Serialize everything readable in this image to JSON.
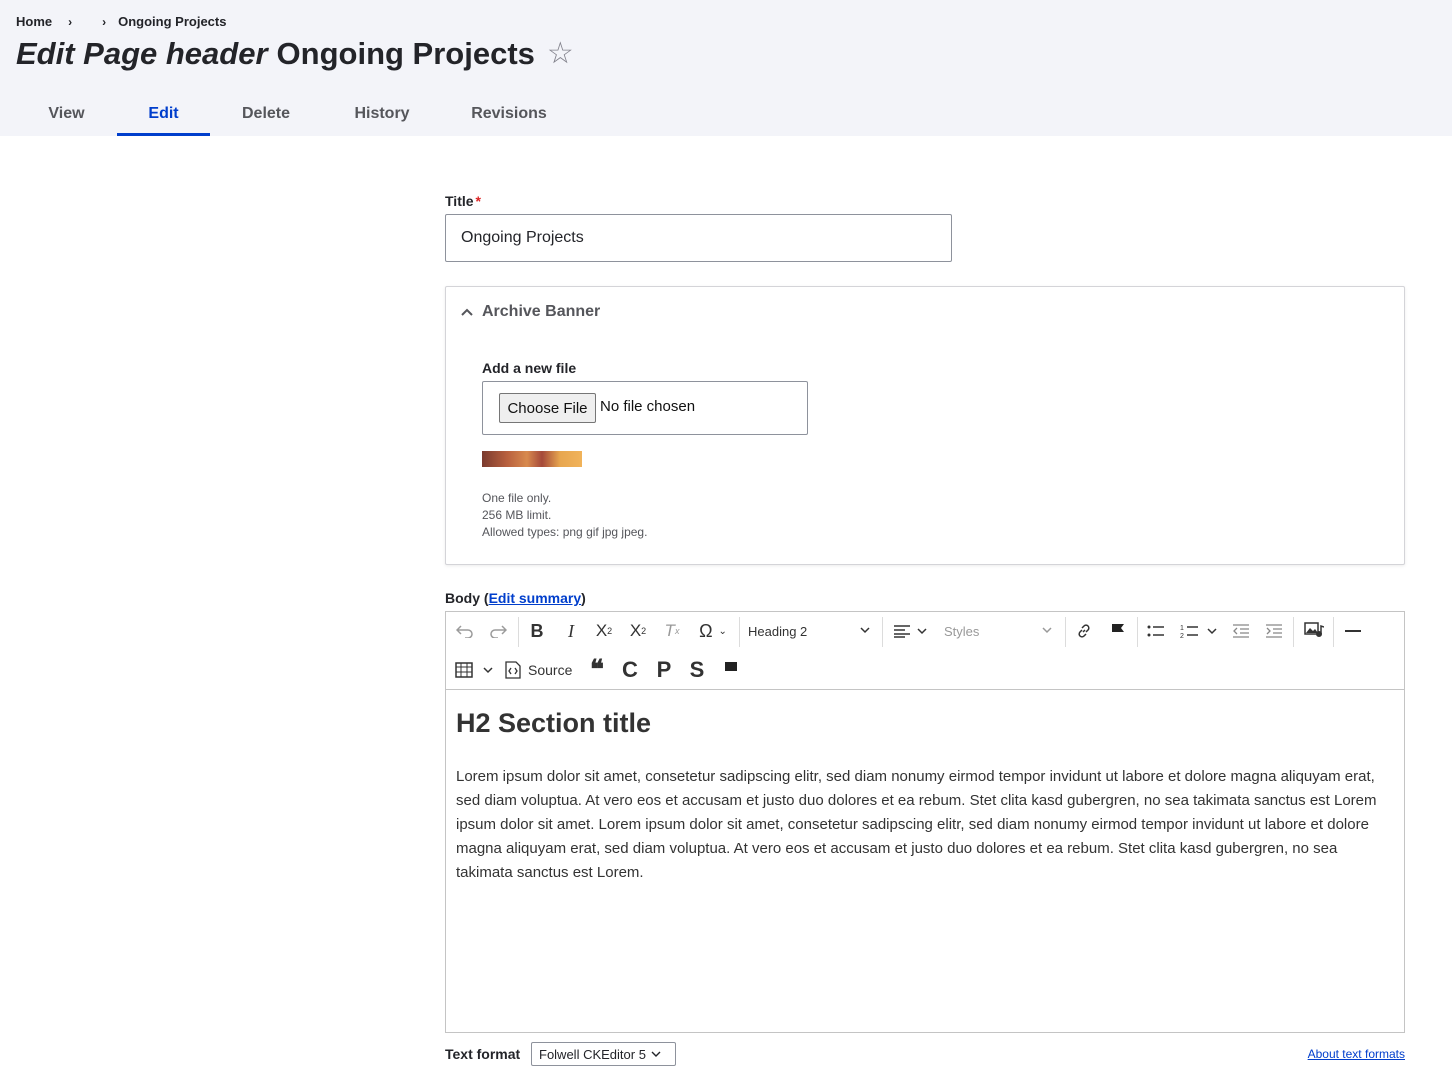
{
  "breadcrumb": {
    "home": "Home",
    "sep1": "›",
    "sep2": "›",
    "current": "Ongoing Projects"
  },
  "page": {
    "title_italic": "Edit Page header",
    "title_rest": "Ongoing Projects",
    "star": "☆"
  },
  "tabs": [
    {
      "label": "View",
      "active": false
    },
    {
      "label": "Edit",
      "active": true
    },
    {
      "label": "Delete",
      "active": false
    },
    {
      "label": "History",
      "active": false
    },
    {
      "label": "Revisions",
      "active": false
    }
  ],
  "form": {
    "title_label": "Title",
    "required_mark": "*",
    "title_value": "Ongoing Projects",
    "archive_banner": {
      "summary": "Archive Banner",
      "add_file_label": "Add a new file",
      "choose_button": "Choose File",
      "no_file": "No file chosen",
      "help": [
        "One file only.",
        "256 MB limit.",
        "Allowed types: png gif jpg jpeg."
      ]
    },
    "body": {
      "label": "Body",
      "open_paren": "(",
      "edit_summary": "Edit summary",
      "close_paren": ")",
      "toolbar": {
        "heading_dropdown": "Heading 2",
        "styles_dropdown": "Styles",
        "source_button": "Source",
        "button_c": "C",
        "button_p": "P",
        "button_s": "S"
      },
      "content": {
        "heading": "H2 Section title",
        "paragraph": "Lorem ipsum dolor sit amet, consetetur sadipscing elitr, sed diam nonumy eirmod tempor invidunt ut labore et dolore magna aliquyam erat, sed diam voluptua. At vero eos et accusam et justo duo dolores et ea rebum. Stet clita kasd gubergren, no sea takimata sanctus est Lorem ipsum dolor sit amet. Lorem ipsum dolor sit amet, consetetur sadipscing elitr, sed diam nonumy eirmod tempor invidunt ut labore et dolore magna aliquyam erat, sed diam voluptua. At vero eos et accusam et justo duo dolores et ea rebum. Stet clita kasd gubergren, no sea takimata sanctus est Lorem."
      }
    },
    "text_format": {
      "label": "Text format",
      "value": "Folwell CKEditor 5",
      "about_link": "About text formats"
    }
  },
  "colors": {
    "accent": "#003ecc",
    "header_bg": "#f3f4f9",
    "required": "#dc2323"
  }
}
